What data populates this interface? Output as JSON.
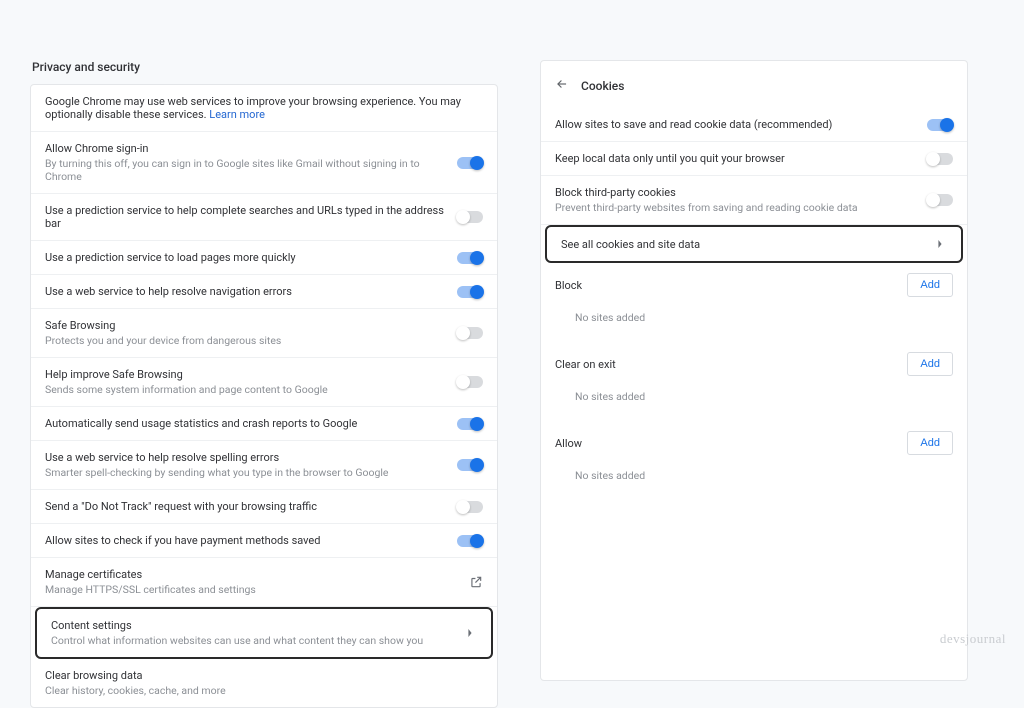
{
  "left": {
    "header": "Privacy and security",
    "intro_prefix": "Google Chrome may use web services to improve your browsing experience. You may optionally disable these services. ",
    "intro_link": "Learn more",
    "items": [
      {
        "title": "Allow Chrome sign-in",
        "subtitle": "By turning this off, you can sign in to Google sites like Gmail without signing in to Chrome",
        "toggle": "on"
      },
      {
        "title": "Use a prediction service to help complete searches and URLs typed in the address bar",
        "subtitle": "",
        "toggle": "off"
      },
      {
        "title": "Use a prediction service to load pages more quickly",
        "subtitle": "",
        "toggle": "on"
      },
      {
        "title": "Use a web service to help resolve navigation errors",
        "subtitle": "",
        "toggle": "on"
      },
      {
        "title": "Safe Browsing",
        "subtitle": "Protects you and your device from dangerous sites",
        "toggle": "off"
      },
      {
        "title": "Help improve Safe Browsing",
        "subtitle": "Sends some system information and page content to Google",
        "toggle": "off"
      },
      {
        "title": "Automatically send usage statistics and crash reports to Google",
        "subtitle": "",
        "toggle": "on"
      },
      {
        "title": "Use a web service to help resolve spelling errors",
        "subtitle": "Smarter spell-checking by sending what you type in the browser to Google",
        "toggle": "on"
      },
      {
        "title": "Send a \"Do Not Track\" request with your browsing traffic",
        "subtitle": "",
        "toggle": "off"
      },
      {
        "title": "Allow sites to check if you have payment methods saved",
        "subtitle": "",
        "toggle": "on"
      }
    ],
    "manage_certs": {
      "title": "Manage certificates",
      "subtitle": "Manage HTTPS/SSL certificates and settings"
    },
    "content_settings": {
      "title": "Content settings",
      "subtitle": "Control what information websites can use and what content they can show you"
    },
    "clear_data": {
      "title": "Clear browsing data",
      "subtitle": "Clear history, cookies, cache, and more"
    }
  },
  "right": {
    "header": "Cookies",
    "rows": [
      {
        "title": "Allow sites to save and read cookie data (recommended)",
        "subtitle": "",
        "toggle": "on"
      },
      {
        "title": "Keep local data only until you quit your browser",
        "subtitle": "",
        "toggle": "off"
      },
      {
        "title": "Block third-party cookies",
        "subtitle": "Prevent third-party websites from saving and reading cookie data",
        "toggle": "off"
      }
    ],
    "see_all": "See all cookies and site data",
    "sections": [
      {
        "label": "Block",
        "add": "Add",
        "empty": "No sites added"
      },
      {
        "label": "Clear on exit",
        "add": "Add",
        "empty": "No sites added"
      },
      {
        "label": "Allow",
        "add": "Add",
        "empty": "No sites added"
      }
    ]
  },
  "watermark": "devsjournal"
}
